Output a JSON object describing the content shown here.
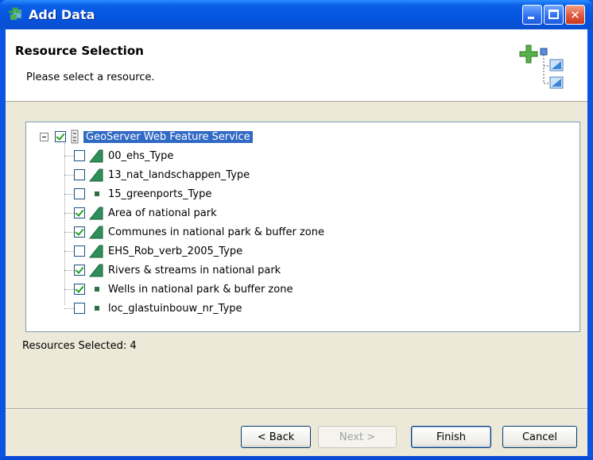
{
  "window": {
    "title": "Add Data"
  },
  "header": {
    "title": "Resource Selection",
    "description": "Please select a resource."
  },
  "tree": {
    "root": {
      "label": "GeoServer Web Feature Service",
      "checked": true,
      "icon": "service-icon"
    },
    "items": [
      {
        "label": "00_ehs_Type",
        "checked": false,
        "icon": "polygon-layer-icon"
      },
      {
        "label": "13_nat_landschappen_Type",
        "checked": false,
        "icon": "polygon-layer-icon"
      },
      {
        "label": "15_greenports_Type",
        "checked": false,
        "icon": "point-layer-icon"
      },
      {
        "label": "Area of national park",
        "checked": true,
        "icon": "polygon-layer-icon"
      },
      {
        "label": "Communes in national park & buffer zone",
        "checked": true,
        "icon": "polygon-layer-icon"
      },
      {
        "label": "EHS_Rob_verb_2005_Type",
        "checked": false,
        "icon": "polygon-layer-icon"
      },
      {
        "label": "Rivers & streams in national park",
        "checked": true,
        "icon": "polygon-layer-icon"
      },
      {
        "label": "Wells in national park & buffer zone",
        "checked": true,
        "icon": "point-layer-icon"
      },
      {
        "label": "loc_glastuinbouw_nr_Type",
        "checked": false,
        "icon": "point-layer-icon"
      }
    ]
  },
  "status": {
    "text": "Resources Selected: 4"
  },
  "buttons": {
    "back": "< Back",
    "next": "Next >",
    "finish": "Finish",
    "cancel": "Cancel"
  }
}
